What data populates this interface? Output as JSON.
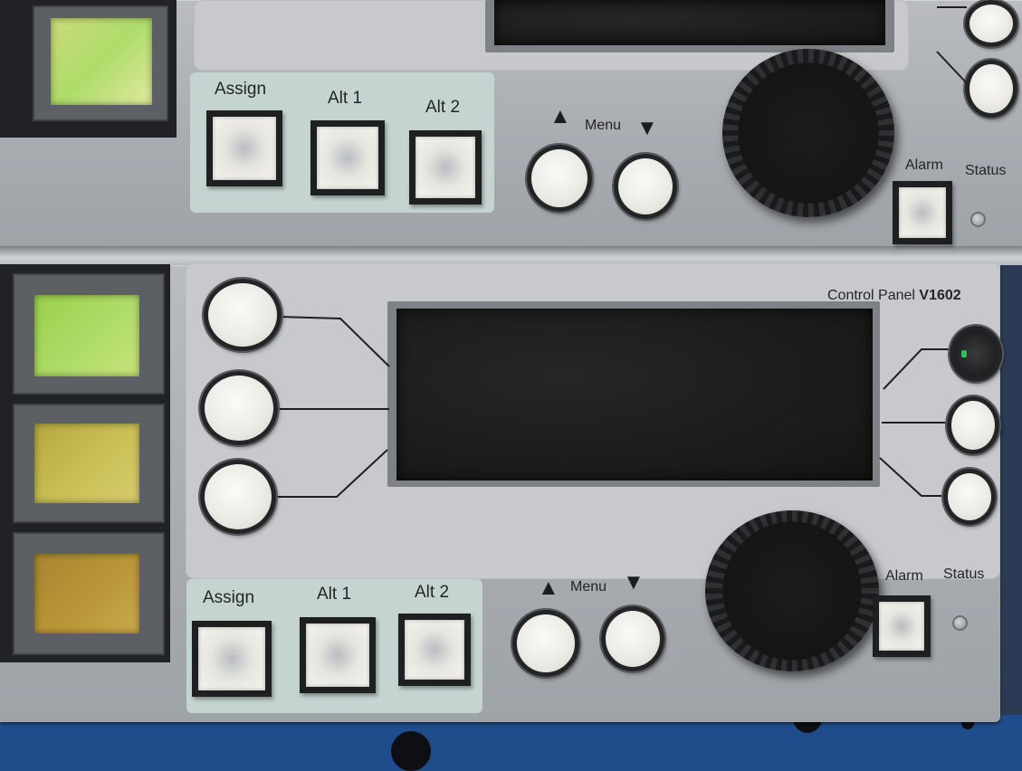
{
  "top_panel": {
    "assign_label": "Assign",
    "alt1_label": "Alt 1",
    "alt2_label": "Alt 2",
    "menu_label": "Menu",
    "alarm_label": "Alarm",
    "status_label": "Status",
    "up_arrow": "▲",
    "down_arrow": "▼"
  },
  "bottom_panel": {
    "title_prefix": "Control Panel",
    "model": "V1602",
    "assign_label": "Assign",
    "alt1_label": "Alt 1",
    "alt2_label": "Alt 2",
    "menu_label": "Menu",
    "alarm_label": "Alarm",
    "status_label": "Status",
    "up_arrow": "▲",
    "down_arrow": "▼"
  },
  "colors": {
    "panel": "#aeb2b6",
    "button_strip": "#c5d4d0",
    "lcd": "#1a1a1b",
    "indicator_1": "#aedc6a",
    "indicator_2": "#c9c056",
    "indicator_3": "#b99738",
    "rack": "#1f4c8a",
    "softkey_led": "#2fbf5a"
  }
}
